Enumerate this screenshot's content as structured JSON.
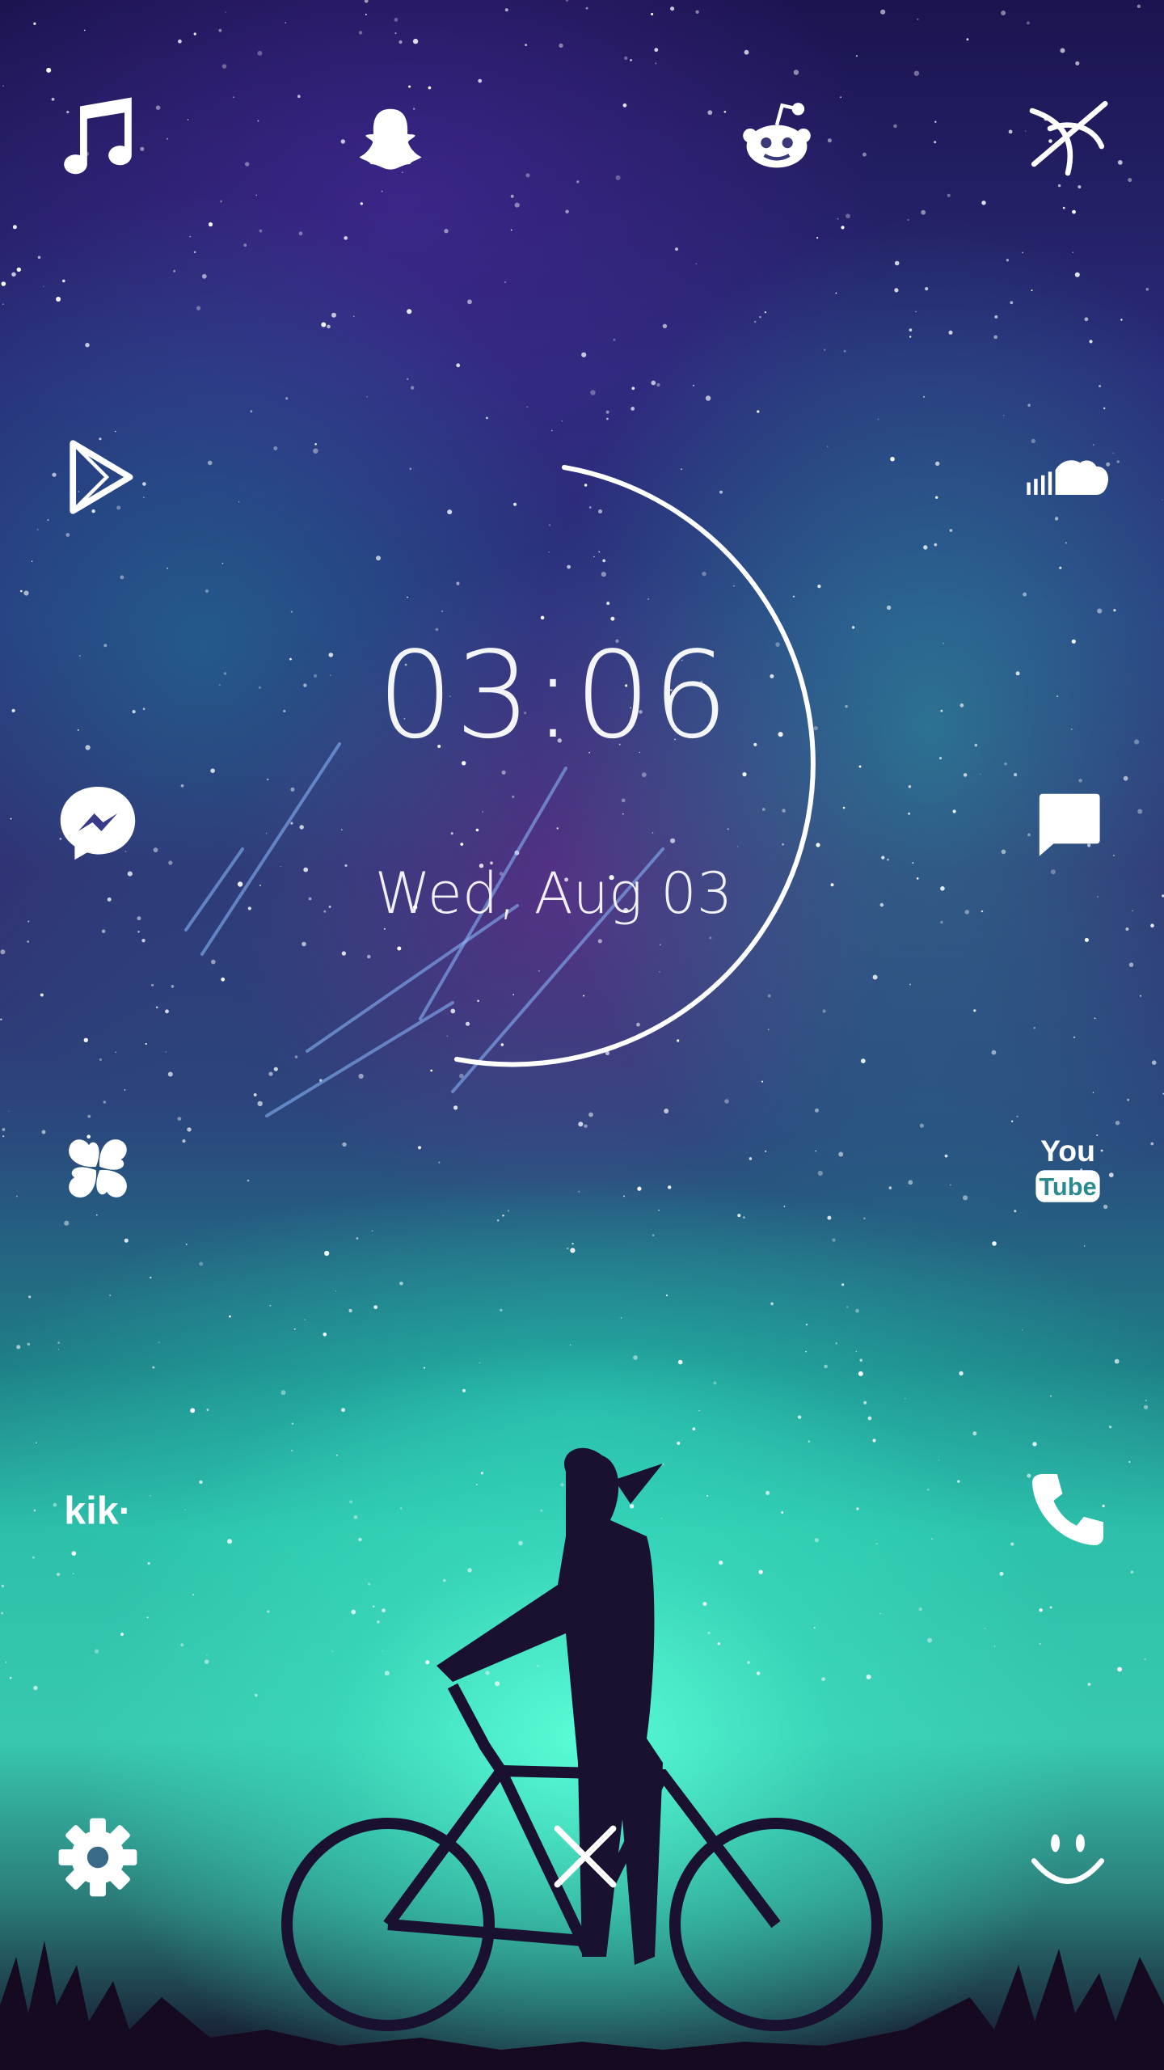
{
  "lockscreen": {
    "time": "03:06",
    "date": "Wed, Aug 03"
  },
  "shortcuts": {
    "top_row": [
      "music-icon",
      "snapchat-ghost-icon",
      "reddit-icon",
      "crossed-circle-icon"
    ],
    "left_column": [
      "play-store-icon",
      "messenger-icon",
      "clover-icon",
      "kik-icon",
      "settings-gear-icon"
    ],
    "right_column": [
      "soundcloud-icon",
      "message-bubble-icon",
      "youtube-icon",
      "phone-icon",
      "smiley-icon"
    ],
    "kik_label": "kik·",
    "youtube_label_top": "You",
    "youtube_label_bottom": "Tube",
    "bottom_center": "unlock-x-icon"
  },
  "colors": {
    "icon": "#ffffff",
    "arc": "#ffffff",
    "aurora": "#3fd6b8",
    "sky_top": "#1b1450"
  }
}
